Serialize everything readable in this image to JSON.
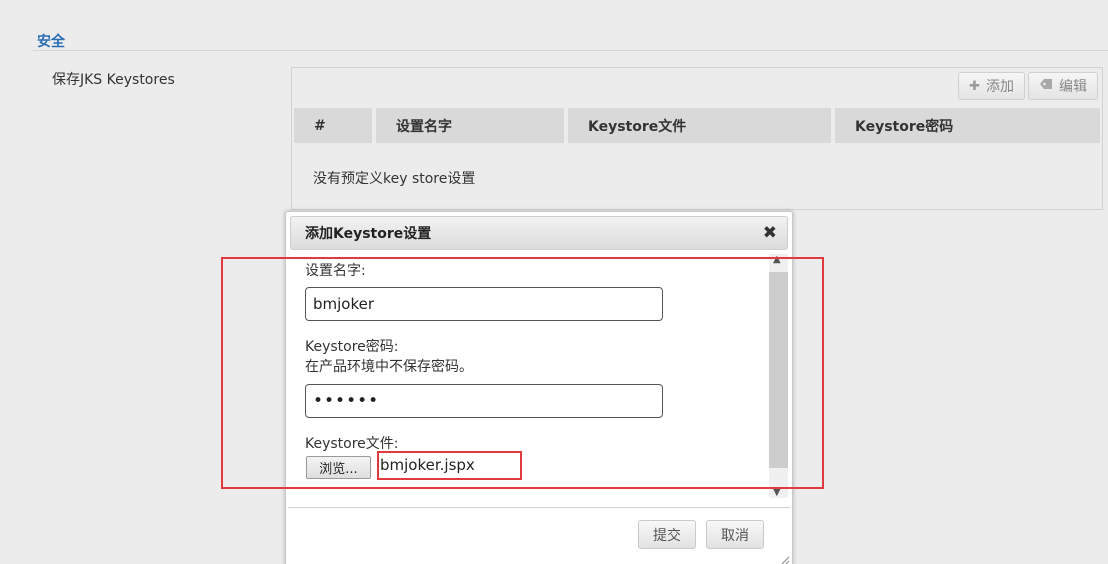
{
  "section": {
    "title": "安全"
  },
  "keystores": {
    "label": "保存JKS Keystores",
    "toolbar": {
      "add_label": "添加",
      "edit_label": "编辑"
    },
    "table": {
      "columns": [
        "#",
        "设置名字",
        "Keystore文件",
        "Keystore密码"
      ],
      "empty_message": "没有预定义key store设置"
    }
  },
  "dialog": {
    "title": "添加Keystore设置",
    "name_label": "设置名字:",
    "name_value": "bmjoker",
    "password_label": "Keystore密码:",
    "password_note": "在产品环境中不保存密码。",
    "password_value": "••••••",
    "file_label": "Keystore文件:",
    "browse_label": "浏览...",
    "file_value": "bmjoker.jspx",
    "submit_label": "提交",
    "cancel_label": "取消"
  },
  "colors": {
    "accent": "#2a6db5",
    "highlight": "#e0393e"
  }
}
